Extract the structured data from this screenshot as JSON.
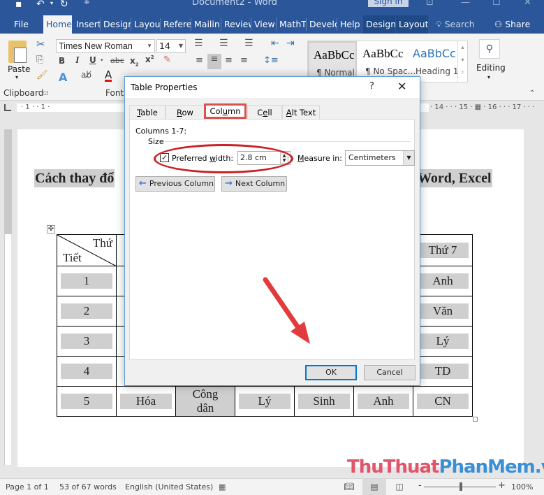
{
  "window": {
    "title": "Document2  -  Word",
    "signin": "Sign in",
    "icons": [
      "save-icon",
      "undo-icon",
      "redo-icon",
      "customize-qat-icon"
    ]
  },
  "tabs": [
    {
      "label": "File"
    },
    {
      "label": "Home",
      "active": true
    },
    {
      "label": "Insert"
    },
    {
      "label": "Design"
    },
    {
      "label": "Layout"
    },
    {
      "label": "References"
    },
    {
      "label": "Mailings"
    },
    {
      "label": "Review"
    },
    {
      "label": "View"
    },
    {
      "label": "MathType"
    },
    {
      "label": "Developer"
    },
    {
      "label": "Help"
    },
    {
      "label": "Design",
      "contextual": true
    },
    {
      "label": "Layout",
      "contextual": true
    }
  ],
  "tab_display": [
    "File",
    "Home",
    "Insert",
    "Desigr",
    "Layout",
    "Referei",
    "Mailin",
    "Review",
    "View",
    "MathT:",
    "Develo",
    "Help",
    "Design",
    "Layout"
  ],
  "search": {
    "label": "Search"
  },
  "share": {
    "label": "Share"
  },
  "ribbon": {
    "clipboard": {
      "paste": "Paste",
      "group": "Clipboard"
    },
    "font": {
      "name": "Times New Roman",
      "size": "14",
      "group": "Font"
    },
    "styles": [
      {
        "sample": "AaBbCc",
        "name": "¶ Normal",
        "selected": true
      },
      {
        "sample": "AaBbCc",
        "name": "¶ No Spac..."
      },
      {
        "sample": "AaBbCc",
        "name": "Heading 1"
      }
    ],
    "editing": "Editing"
  },
  "ruler": {
    "left": "· 1 · · 1 ·",
    "right": "· 14 · · · 15 · ▦ · 16 · · · 17 · · ·"
  },
  "document": {
    "heading_left": "Cách thay đổ",
    "heading_right": "Word, Excel",
    "table": {
      "header_top": "Thứ",
      "header_bottom": "Tiết",
      "col7_header": "Thứ 7",
      "rows": [
        {
          "period": "1",
          "col7": "Anh"
        },
        {
          "period": "2",
          "col7": "Văn"
        },
        {
          "period": "3",
          "col7": "Lý"
        },
        {
          "period": "4",
          "col7": "TD"
        },
        {
          "period": "5",
          "cells": [
            "Hóa",
            "Công dân",
            "Lý",
            "Sinh",
            "Anh",
            "CN"
          ]
        }
      ]
    }
  },
  "dialog": {
    "title": "Table Properties",
    "help": "?",
    "close": "✕",
    "tabs": [
      "Table",
      "Row",
      "Column",
      "Cell",
      "Alt Text"
    ],
    "active_tab": "Column",
    "columns_label": "Columns 1-7:",
    "size_label": "Size",
    "preferred_width_label": "Preferred width:",
    "preferred_width_checked": true,
    "preferred_width_value": "2.8 cm",
    "measure_in_label": "Measure in:",
    "measure_in_value": "Centimeters",
    "prev_column": "Previous Column",
    "next_column": "Next Column",
    "ok": "OK",
    "cancel": "Cancel",
    "highlight_color": "#cc1f25"
  },
  "statusbar": {
    "page": "Page 1 of 1",
    "words": "53 of 67 words",
    "language": "English (United States)",
    "zoom": "100%",
    "zoom_level_percent": 100
  },
  "watermark": {
    "part1": "ThuThuat",
    "part2": "PhanMem.vn"
  }
}
